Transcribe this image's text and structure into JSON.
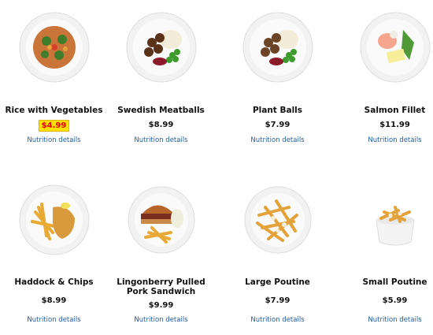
{
  "menu": {
    "items": [
      {
        "name": "Rice with Vegetables",
        "price": "$4.99",
        "link": "Nutrition details",
        "icon": "rice-vegetables-plate-icon"
      },
      {
        "name": "Swedish Meatballs",
        "price": "$8.99",
        "link": "Nutrition details",
        "icon": "meatballs-plate-icon"
      },
      {
        "name": "Plant Balls",
        "price": "$7.99",
        "link": "Nutrition details",
        "icon": "plant-balls-plate-icon"
      },
      {
        "name": "Salmon Fillet",
        "price": "$11.99",
        "link": "Nutrition details",
        "icon": "salmon-plate-icon"
      },
      {
        "name": "Haddock & Chips",
        "price": "$8.99",
        "link": "Nutrition details",
        "icon": "fish-chips-plate-icon"
      },
      {
        "name": "Lingonberry Pulled Pork Sandwich",
        "price": "$9.99",
        "link": "Nutrition details",
        "icon": "sandwich-plate-icon"
      },
      {
        "name": "Large Poutine",
        "price": "$7.99",
        "link": "Nutrition details",
        "icon": "large-poutine-plate-icon"
      },
      {
        "name": "Small Poutine",
        "price": "$5.99",
        "link": "Nutrition details",
        "icon": "small-poutine-bowl-icon"
      }
    ]
  },
  "colors": {
    "highlight": "#ffe000",
    "highlight_text": "#e50000",
    "link": "#1f5ea8"
  }
}
